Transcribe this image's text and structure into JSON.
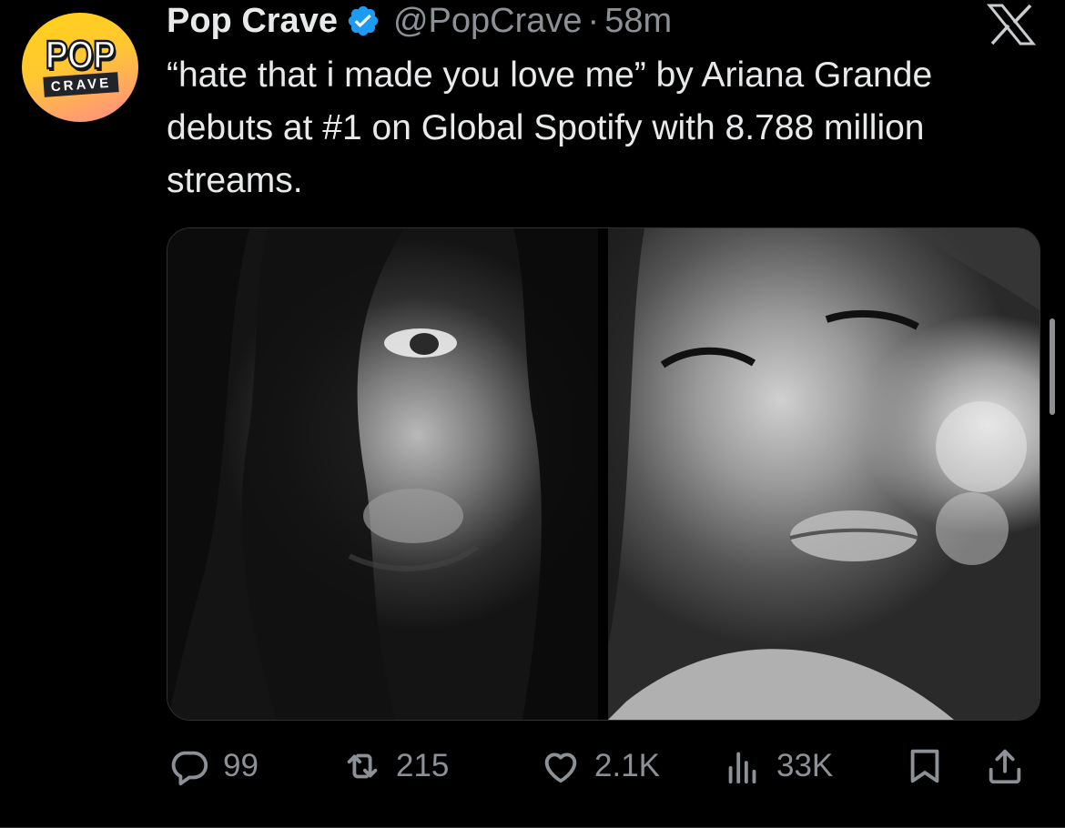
{
  "tweet": {
    "author_name": "Pop Crave",
    "handle": "@PopCrave",
    "separator": "·",
    "time": "58m",
    "verified": true,
    "avatar": {
      "line1": "POP",
      "line2": "CRAVE"
    },
    "text": "“hate that i made you love me” by Ariana Grande debuts at #1 on Global Spotify with 8.788 million streams.",
    "media_count": 2
  },
  "actions": {
    "replies": "99",
    "reposts": "215",
    "likes": "2.1K",
    "views": "33K"
  },
  "colors": {
    "background": "#000000",
    "text": "#e7e9ea",
    "secondary": "#8b9196",
    "verified_badge": "#1d9bf0"
  },
  "icons": [
    "x-logo-icon",
    "verified-badge-icon",
    "reply-icon",
    "repost-icon",
    "like-icon",
    "views-icon",
    "bookmark-icon",
    "share-icon"
  ]
}
